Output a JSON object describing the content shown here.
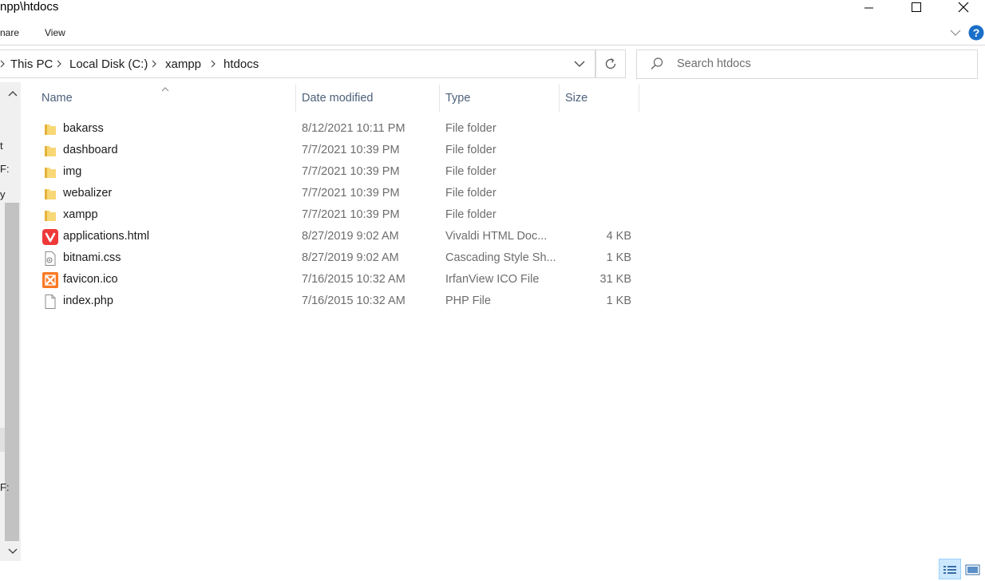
{
  "window": {
    "title": "npp\\htdocs"
  },
  "ribbon": {
    "tabs": [
      "nare",
      "View"
    ]
  },
  "address": {
    "crumbs": [
      "This PC",
      "Local Disk (C:)",
      "xampp",
      "htdocs"
    ]
  },
  "search": {
    "placeholder": "Search htdocs"
  },
  "nav_fragments": [
    "t",
    "F:",
    "y",
    "F:"
  ],
  "columns": {
    "name": "Name",
    "date": "Date modified",
    "type": "Type",
    "size": "Size"
  },
  "files": [
    {
      "name": "bakarss",
      "date": "8/12/2021 10:11 PM",
      "type": "File folder",
      "size": "",
      "icon": "folder-icon"
    },
    {
      "name": "dashboard",
      "date": "7/7/2021 10:39 PM",
      "type": "File folder",
      "size": "",
      "icon": "folder-icon"
    },
    {
      "name": "img",
      "date": "7/7/2021 10:39 PM",
      "type": "File folder",
      "size": "",
      "icon": "folder-icon"
    },
    {
      "name": "webalizer",
      "date": "7/7/2021 10:39 PM",
      "type": "File folder",
      "size": "",
      "icon": "folder-icon"
    },
    {
      "name": "xampp",
      "date": "7/7/2021 10:39 PM",
      "type": "File folder",
      "size": "",
      "icon": "folder-icon"
    },
    {
      "name": "applications.html",
      "date": "8/27/2019 9:02 AM",
      "type": "Vivaldi HTML Doc...",
      "size": "4 KB",
      "icon": "vivaldi-html-icon"
    },
    {
      "name": "bitnami.css",
      "date": "8/27/2019 9:02 AM",
      "type": "Cascading Style Sh...",
      "size": "1 KB",
      "icon": "css-file-icon"
    },
    {
      "name": "favicon.ico",
      "date": "7/16/2015 10:32 AM",
      "type": "IrfanView ICO File",
      "size": "31 KB",
      "icon": "xampp-ico-icon"
    },
    {
      "name": "index.php",
      "date": "7/16/2015 10:32 AM",
      "type": "PHP File",
      "size": "1 KB",
      "icon": "blank-file-icon"
    }
  ],
  "colors": {
    "accent": "#0063b1",
    "folder": "#f8d775",
    "vivaldi": "#ef3939",
    "xampp": "#fb7a24"
  }
}
